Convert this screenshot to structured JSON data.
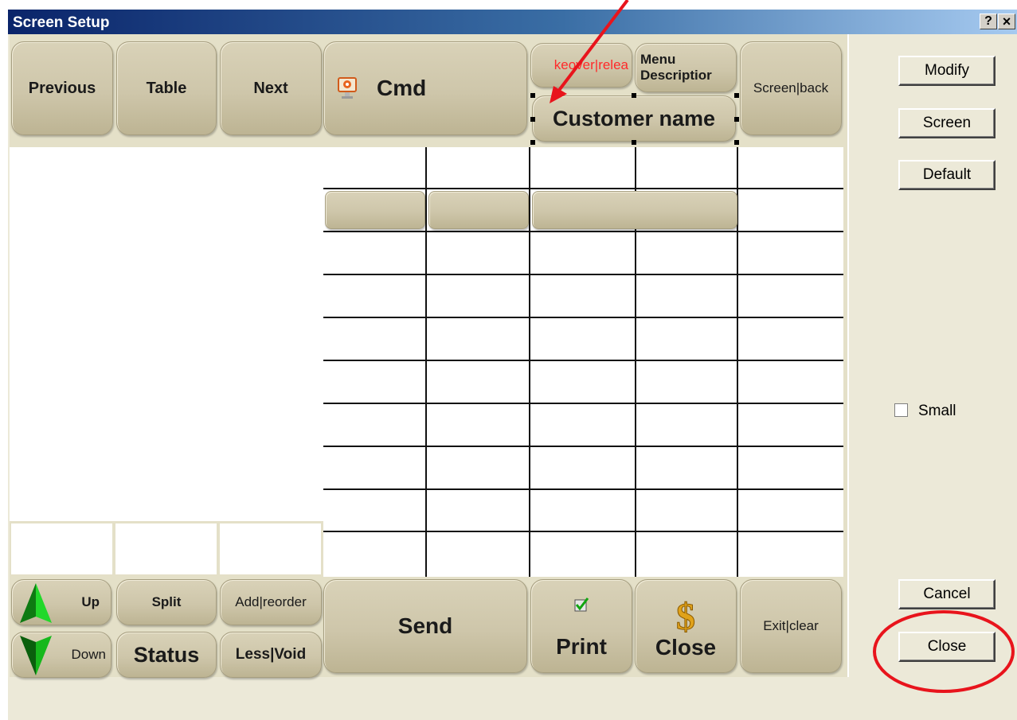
{
  "window": {
    "title": "Screen Setup",
    "help_label": "?",
    "close_label": "×"
  },
  "toolbar": {
    "previous": "Previous",
    "table": "Table",
    "next": "Next",
    "cmd": "Cmd",
    "takeover": "keover|relea",
    "menu_description": "Menu Descriptior",
    "screen_back": "Screen|back",
    "customer_name": "Customer name"
  },
  "bottom_bar": {
    "up": "Up",
    "down": "Down",
    "split": "Split",
    "status": "Status",
    "add_reorder": "Add|reorder",
    "less_void": "Less|Void",
    "send": "Send",
    "print": "Print",
    "close": "Close",
    "exit_clear": "Exit|clear"
  },
  "side_panel": {
    "modify": "Modify",
    "screen": "Screen",
    "default": "Default",
    "small_label": "Small",
    "small_checked": false,
    "cancel": "Cancel",
    "close": "Close"
  },
  "colors": {
    "annotation_red": "#e8141c",
    "takeover_text": "#ff2a2a",
    "arrow_up_green": "#18c81e",
    "dollar_gold": "#e0a21a"
  },
  "icons": [
    "pos-monitor-icon",
    "arrow-up-icon",
    "arrow-down-icon",
    "check-icon",
    "dollar-icon"
  ]
}
